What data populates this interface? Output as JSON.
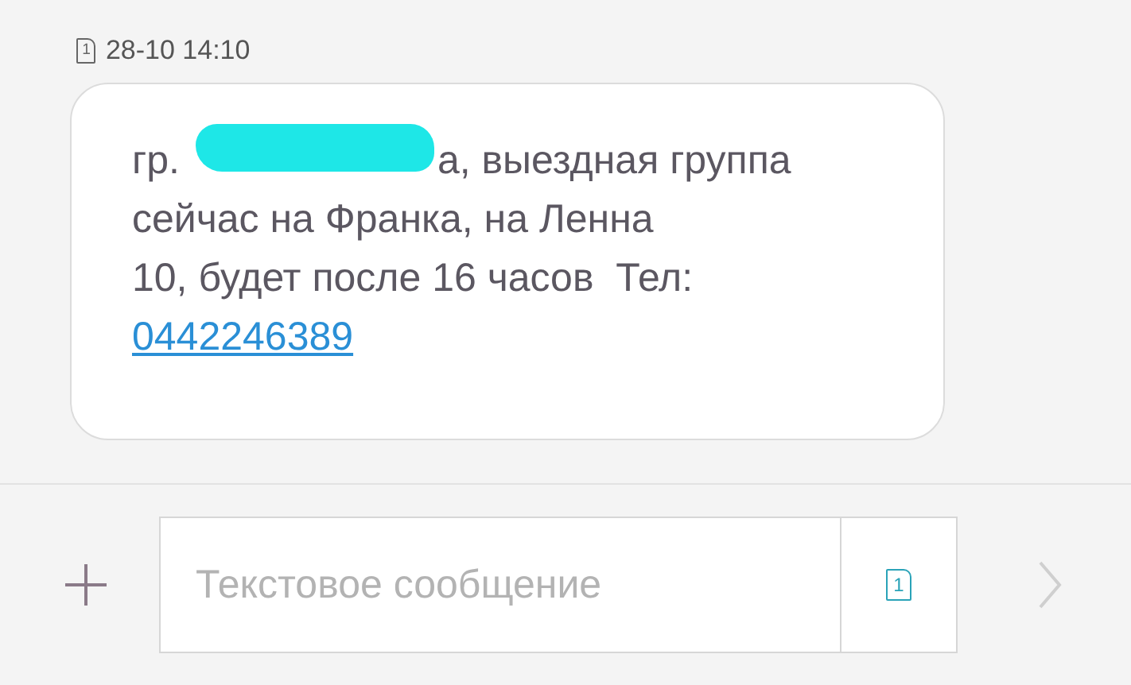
{
  "message": {
    "sim": "1",
    "time": "28-10 14:10",
    "first_line_start": "гр.",
    "first_line_end": "а, выездная группа",
    "lines": [
      "сейчас на Франка, на Ленна",
      "10, будет после 16 часов  Тел:"
    ],
    "phone": "0442246389"
  },
  "composer": {
    "placeholder": "Текстовое сообщение",
    "sim": "1"
  }
}
